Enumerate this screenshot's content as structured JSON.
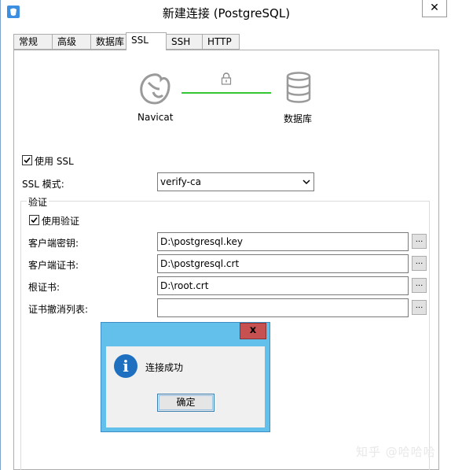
{
  "window": {
    "title": "新建连接 (PostgreSQL)",
    "close_glyph": "✕"
  },
  "tabs": [
    {
      "label": "常规"
    },
    {
      "label": "高级"
    },
    {
      "label": "数据库"
    },
    {
      "label": "SSL",
      "active": true
    },
    {
      "label": "SSH"
    },
    {
      "label": "HTTP"
    }
  ],
  "diagram": {
    "left_label": "Navicat",
    "right_label": "数据库",
    "link_color": "#34c734",
    "icons": [
      "navicat-logo-icon",
      "lock-icon",
      "database-icon"
    ]
  },
  "ssl": {
    "use_ssl_label": "使用 SSL",
    "use_ssl_checked": true,
    "mode_label": "SSL 模式:",
    "mode_value": "verify-ca"
  },
  "auth": {
    "group_title": "验证",
    "use_auth_label": "使用验证",
    "use_auth_checked": true,
    "fields": [
      {
        "label": "客户端密钥:",
        "value": "D:\\postgresql.key"
      },
      {
        "label": "客户端证书:",
        "value": "D:\\postgresql.crt"
      },
      {
        "label": "根证书:",
        "value": "D:\\root.crt"
      },
      {
        "label": "证书撤消列表:",
        "value": ""
      }
    ],
    "browse_label": "..."
  },
  "dialog": {
    "close_glyph": "x",
    "message": "连接成功",
    "ok_label": "确定",
    "accent_color": "#62c0ea"
  },
  "watermark": "知乎 @哈哈哈"
}
